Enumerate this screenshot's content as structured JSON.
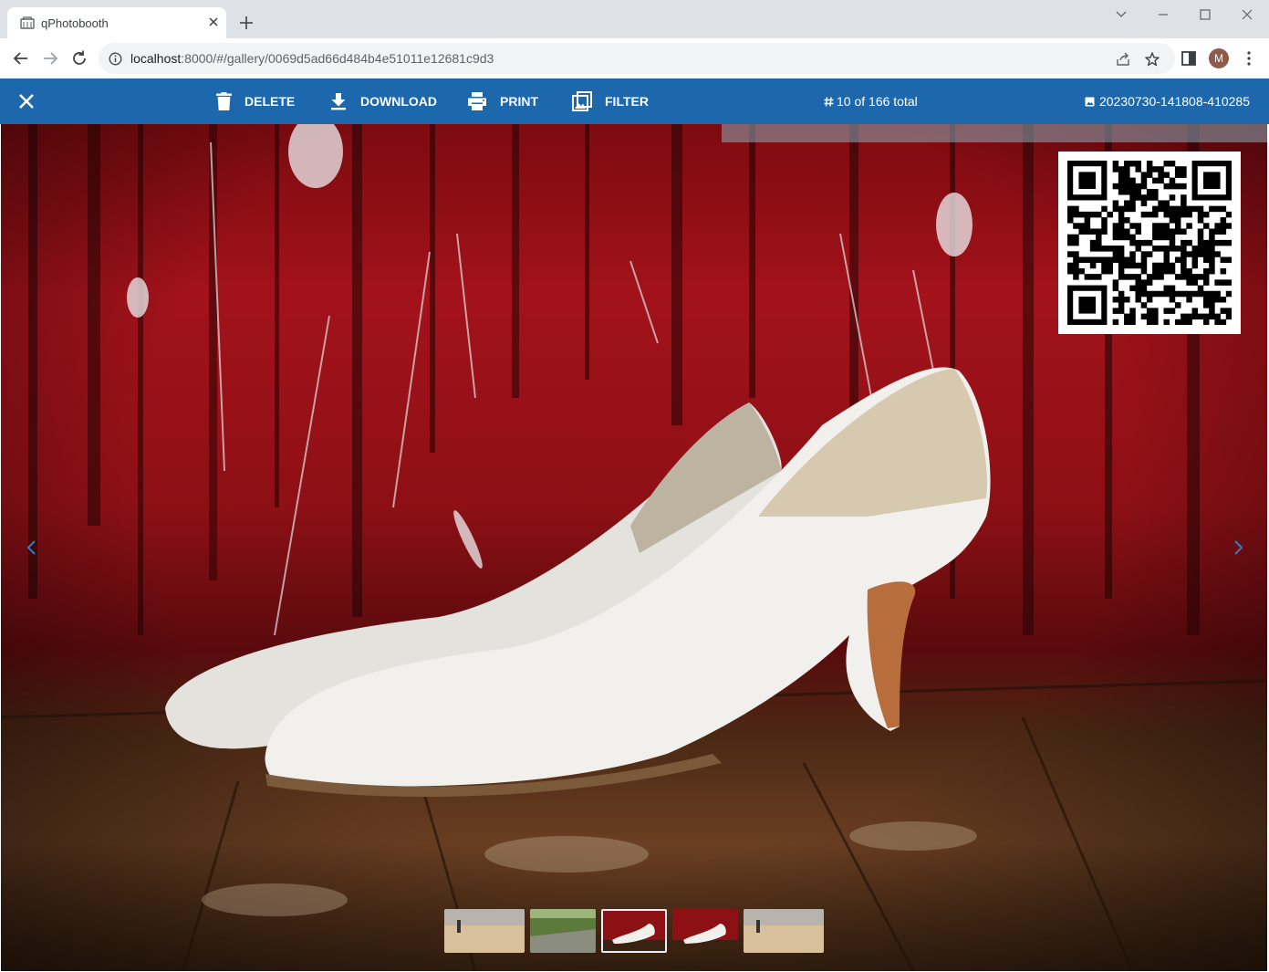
{
  "browser": {
    "tab_title": "qPhotobooth",
    "url_host": "localhost",
    "url_rest": ":8000/#/gallery/0069d5ad66d484b4e51011e12681c9d3",
    "avatar_letter": "M"
  },
  "appbar": {
    "delete_label": "DELETE",
    "download_label": "DOWNLOAD",
    "print_label": "PRINT",
    "filter_label": "FILTER",
    "counter_text": "10 of 166 total",
    "filename": "20230730-141808-410285",
    "bg_color": "#1d67ad"
  },
  "icons": {
    "close": "close-icon",
    "delete": "trash-icon",
    "download": "download-icon",
    "print": "printer-icon",
    "filter": "image-filter-icon",
    "counter": "hash-icon",
    "filename": "image-icon"
  },
  "thumbnails": [
    {
      "subject": "person on sand",
      "active": false
    },
    {
      "subject": "forest river",
      "active": false
    },
    {
      "subject": "white shoes on red",
      "active": true
    },
    {
      "subject": "white shoes on red",
      "active": false
    },
    {
      "subject": "person on sand",
      "active": false
    }
  ]
}
